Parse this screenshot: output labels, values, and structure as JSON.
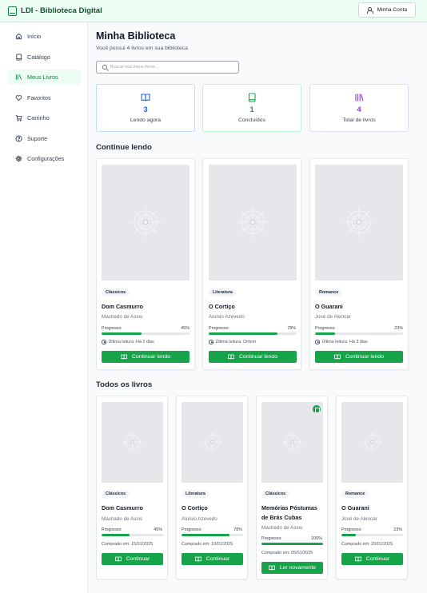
{
  "header": {
    "app_title": "LDI - Biblioteca Digital",
    "account_label": "Minha Conta"
  },
  "sidebar": {
    "items": [
      {
        "label": "Início",
        "icon": "home-icon",
        "active": false
      },
      {
        "label": "Catálogo",
        "icon": "book-icon",
        "active": false
      },
      {
        "label": "Meus Livros",
        "icon": "library-icon",
        "active": true
      },
      {
        "label": "Favoritos",
        "icon": "heart-icon",
        "active": false
      },
      {
        "label": "Carrinho",
        "icon": "cart-icon",
        "active": false
      },
      {
        "label": "Suporte",
        "icon": "help-circle-icon",
        "active": false
      },
      {
        "label": "Configurações",
        "icon": "gear-icon",
        "active": false
      }
    ]
  },
  "main": {
    "title": "Minha Biblioteca",
    "subtitle": "Você possui 4 livros em sua biblioteca",
    "search": {
      "placeholder": "Buscar nos meus livros..."
    },
    "stats": [
      {
        "value": "3",
        "label": "Lendo agora",
        "icon": "book-open-icon",
        "color": "#2563eb",
        "border": "#bfdbfe"
      },
      {
        "value": "1",
        "label": "Concluídos",
        "icon": "book-icon",
        "color": "#16a34a",
        "border": "#bbf7d0"
      },
      {
        "value": "4",
        "label": "Total de livros",
        "icon": "library-icon",
        "color": "#9333ea",
        "border": "#e9d5ff"
      }
    ],
    "continue_reading": {
      "title": "Continue lendo",
      "books": [
        {
          "category": "Clássicos",
          "title": "Dom Casmurro",
          "author": "Machado de Assis",
          "progress_label": "Progresso",
          "progress_text": "45%",
          "progress": 45,
          "last_read": "Última leitura: Há 2 dias",
          "button": "Continuar lendo"
        },
        {
          "category": "Literatura",
          "title": "O Cortiço",
          "author": "Aluísio Azevedo",
          "progress_label": "Progresso",
          "progress_text": "78%",
          "progress": 78,
          "last_read": "Última leitura: Ontem",
          "button": "Continuar lendo"
        },
        {
          "category": "Romance",
          "title": "O Guarani",
          "author": "José de Alencar",
          "progress_label": "Progresso",
          "progress_text": "23%",
          "progress": 23,
          "last_read": "Última leitura: Há 3 dias",
          "button": "Continuar lendo"
        }
      ]
    },
    "all_books": {
      "title": "Todos os livros",
      "books": [
        {
          "category": "Clássicos",
          "title": "Dom Casmurro",
          "author": "Machado de Assis",
          "progress_label": "Progresso",
          "progress_text": "45%",
          "progress": 45,
          "purchased": "Comprado em: 15/01/2025",
          "button": "Continuar",
          "completed": false
        },
        {
          "category": "Literatura",
          "title": "O Cortiço",
          "author": "Aluísio Azevedo",
          "progress_label": "Progresso",
          "progress_text": "78%",
          "progress": 78,
          "purchased": "Comprado em: 10/01/2025",
          "button": "Continuar",
          "completed": false
        },
        {
          "category": "Clássicos",
          "title": "Memórias Póstumas de Brás Cubas",
          "author": "Machado de Assis",
          "progress_label": "Progresso",
          "progress_text": "100%",
          "progress": 100,
          "purchased": "Comprado em: 05/01/2025",
          "button": "Ler novamente",
          "completed": true
        },
        {
          "category": "Romance",
          "title": "O Guarani",
          "author": "José de Alencar",
          "progress_label": "Progresso",
          "progress_text": "23%",
          "progress": 23,
          "purchased": "Comprado em: 20/01/2025",
          "button": "Continuar",
          "completed": false
        }
      ]
    }
  }
}
